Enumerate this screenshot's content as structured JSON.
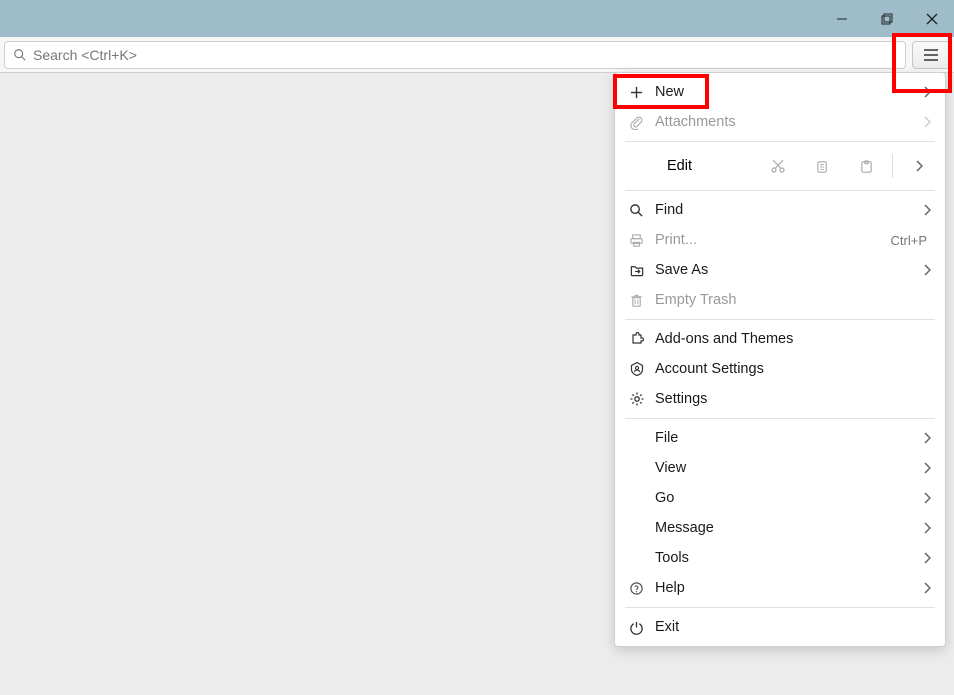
{
  "search": {
    "placeholder": "Search <Ctrl+K>"
  },
  "menu": {
    "new": "New",
    "attachments": "Attachments",
    "edit": "Edit",
    "find": "Find",
    "print": "Print...",
    "print_shortcut": "Ctrl+P",
    "save_as": "Save As",
    "empty_trash": "Empty Trash",
    "addons": "Add-ons and Themes",
    "account_settings": "Account Settings",
    "settings": "Settings",
    "file": "File",
    "view": "View",
    "go": "Go",
    "message": "Message",
    "tools": "Tools",
    "help": "Help",
    "exit": "Exit"
  }
}
